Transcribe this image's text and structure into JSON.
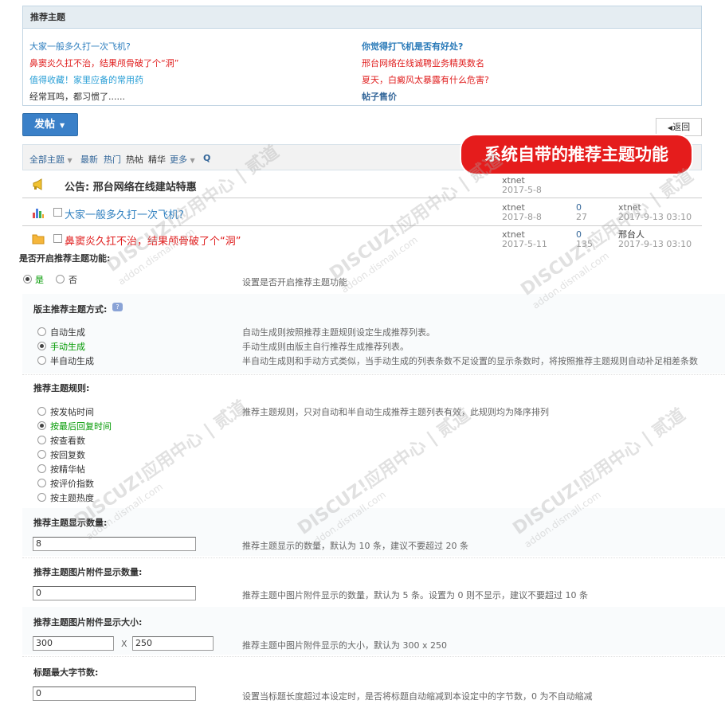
{
  "recommend": {
    "header": "推荐主题",
    "left": [
      {
        "text": "大家一般多久打一次飞机?",
        "color": "#2f7fbf",
        "bold": false
      },
      {
        "text": "鼻窦炎久扛不治，结果颅骨破了个“洞”",
        "color": "#e02020",
        "bold": false
      },
      {
        "text": "值得收藏！家里应备的常用药",
        "color": "#2a9fd6",
        "bold": false
      },
      {
        "text": "经常耳鸣，都习惯了......",
        "color": "#333333",
        "bold": false
      }
    ],
    "right": [
      {
        "text": "你觉得打飞机是否有好处?",
        "color": "#2a7ab8",
        "bold": true
      },
      {
        "text": "邢台网络在线诚聘业务精英数名",
        "color": "#e02020",
        "bold": false
      },
      {
        "text": "夏天，白癜风太暴露有什么危害?",
        "color": "#e02020",
        "bold": false
      },
      {
        "text": "帖子售价",
        "color": "#336699",
        "bold": true
      }
    ]
  },
  "toolbar": {
    "post_label": "发帖",
    "back_label": "返回",
    "all_threads": "全部主题",
    "latest": "最新",
    "hot": "热门",
    "hot_posts": "热帖",
    "digest": "精华",
    "more": "更多",
    "search_glyph": "Q"
  },
  "threads": [
    {
      "prefix": "公告:",
      "title": "邢台网络在线建站特惠",
      "title_color": "#333333",
      "author": "xtnet",
      "date": "2017-5-8",
      "replies": "",
      "views": "",
      "last_user": "",
      "last_time": "",
      "icon": "megaphone-icon"
    },
    {
      "prefix": "",
      "title": "大家一般多久打一次飞机?",
      "title_color": "#2f7fbf",
      "author": "xtnet",
      "date": "2017-8-8",
      "replies": "0",
      "views": "27",
      "last_user": "xtnet",
      "last_time": "2017-9-13 03:10",
      "icon": "poll-icon"
    },
    {
      "prefix": "",
      "title": "鼻窦炎久扛不治，结果颅骨破了个“洞”",
      "title_color": "#e02020",
      "author": "xtnet",
      "date": "2017-5-11",
      "replies": "0",
      "views": "135",
      "last_user": "邢台人",
      "last_time": "2017-9-13 03:10",
      "icon": "folder-icon"
    }
  ],
  "annotation": "系统自带的推荐主题功能",
  "settings": {
    "enable": {
      "title": "是否开启推荐主题功能:",
      "yes": "是",
      "no": "否",
      "desc": "设置是否开启推荐主题功能"
    },
    "mode": {
      "title": "版主推荐主题方式:",
      "options": [
        "自动生成",
        "手动生成",
        "半自动生成"
      ],
      "selected": 1,
      "descs": [
        "自动生成则按照推荐主题规则设定生成推荐列表。",
        "手动生成则由版主自行推荐生成推荐列表。",
        "半自动生成则和手动方式类似，当手动生成的列表条数不足设置的显示条数时，将按照推荐主题规则自动补足相差条数"
      ]
    },
    "rule": {
      "title": "推荐主题规则:",
      "options": [
        "按发帖时间",
        "按最后回复时间",
        "按查看数",
        "按回复数",
        "按精华帖",
        "按评价指数",
        "按主题热度"
      ],
      "selected": 1,
      "desc": "推荐主题规则，只对自动和半自动生成推荐主题列表有效，此规则均为降序排列"
    },
    "count": {
      "title": "推荐主题显示数量:",
      "value": "8",
      "desc": "推荐主题显示的数量，默认为 10 条，建议不要超过 20 条"
    },
    "img_count": {
      "title": "推荐主题图片附件显示数量:",
      "value": "0",
      "desc": "推荐主题中图片附件显示的数量，默认为 5 条。设置为 0 则不显示，建议不要超过 10 条"
    },
    "img_size": {
      "title": "推荐主题图片附件显示大小:",
      "width": "300",
      "x": "X",
      "height": "250",
      "desc": "推荐主题中图片附件显示的大小，默认为 300 x 250"
    },
    "title_len": {
      "title": "标题最大字节数:",
      "value": "0",
      "desc": "设置当标题长度超过本设定时，是否将标题自动缩减到本设定中的字节数，0 为不自动缩减"
    }
  },
  "watermark": {
    "main": "DISCUZ!应用中心 | 贰道",
    "sub": "addon.dismall.com"
  }
}
